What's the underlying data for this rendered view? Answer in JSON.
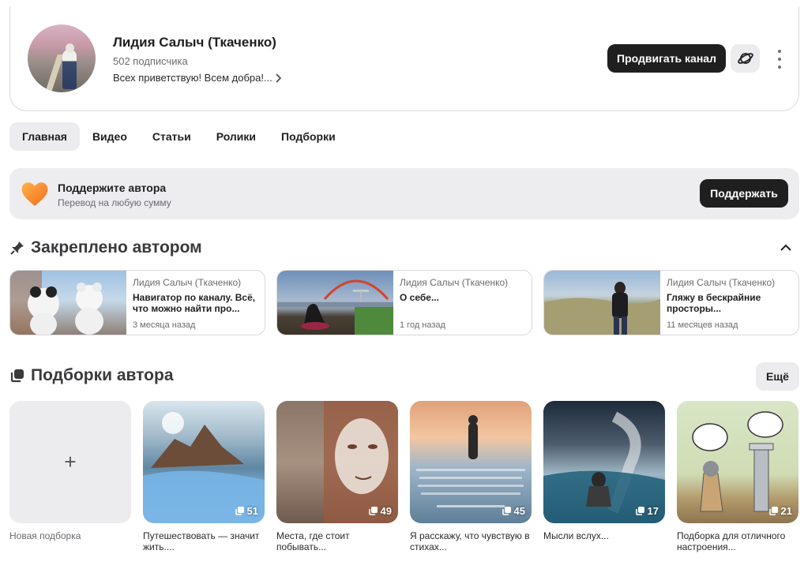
{
  "channel": {
    "name": "Лидия Салыч (Ткаченко)",
    "subscribers": "502 подписчика",
    "description": "Всех приветствую! Всем добра!...",
    "promote_label": "Продвигать канал"
  },
  "tabs": [
    {
      "label": "Главная",
      "active": true
    },
    {
      "label": "Видео",
      "active": false
    },
    {
      "label": "Статьи",
      "active": false
    },
    {
      "label": "Ролики",
      "active": false
    },
    {
      "label": "Подборки",
      "active": false
    }
  ],
  "support": {
    "title": "Поддержите автора",
    "subtitle": "Перевод на любую сумму",
    "button": "Поддержать"
  },
  "pinned": {
    "title": "Закреплено автором",
    "items": [
      {
        "author": "Лидия Салыч (Ткаченко)",
        "title": "Навигатор по каналу. Всё, что можно найти про...",
        "date": "3 месяца назад"
      },
      {
        "author": "Лидия Салыч (Ткаченко)",
        "title": "О себе...",
        "date": "1 год назад"
      },
      {
        "author": "Лидия Салыч (Ткаченко)",
        "title": "Гляжу в бескрайние просторы...",
        "date": "11 месяцев назад"
      }
    ]
  },
  "collections": {
    "title": "Подборки автора",
    "more_label": "Ещё",
    "new_label": "Новая подборка",
    "items": [
      {
        "label": "Путешествовать — значит жить....",
        "count": "51"
      },
      {
        "label": "Места, где стоит побывать...",
        "count": "49"
      },
      {
        "label": "Я расскажу, что чувствую в стихах...",
        "count": "45"
      },
      {
        "label": "Мысли вслух...",
        "count": "17"
      },
      {
        "label": "Подборка для отличного настроения...",
        "count": "21"
      }
    ]
  }
}
